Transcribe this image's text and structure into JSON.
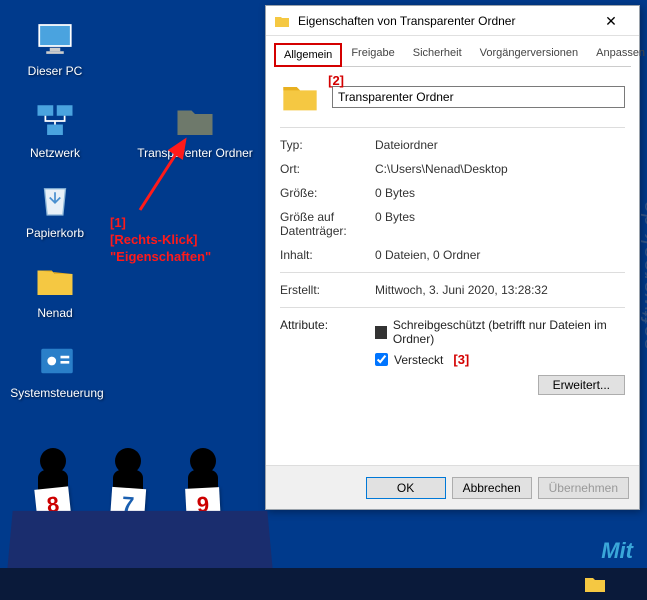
{
  "desktop": {
    "icons": [
      {
        "label": "Dieser PC"
      },
      {
        "label": "Netzwerk"
      },
      {
        "label": "Papierkorb"
      },
      {
        "label": "Nenad"
      },
      {
        "label": "Systemsteuerung"
      },
      {
        "label": "Transparenter Ordner"
      }
    ]
  },
  "annotation": {
    "step1_num": "[1]",
    "step1_action": "[Rechts-Klick]",
    "step1_menu": "\"Eigenschaften\"",
    "step2": "[2]",
    "step3": "[3]"
  },
  "dialog": {
    "title": "Eigenschaften von Transparenter Ordner",
    "tabs": [
      "Allgemein",
      "Freigabe",
      "Sicherheit",
      "Vorgängerversionen",
      "Anpassen"
    ],
    "active_tab": 0,
    "folder_name": "Transparenter Ordner",
    "props": {
      "type_label": "Typ:",
      "type_value": "Dateiordner",
      "loc_label": "Ort:",
      "loc_value": "C:\\Users\\Nenad\\Desktop",
      "size_label": "Größe:",
      "size_value": "0 Bytes",
      "sizeondisk_label": "Größe auf Datenträger:",
      "sizeondisk_value": "0 Bytes",
      "contains_label": "Inhalt:",
      "contains_value": "0 Dateien, 0 Ordner",
      "created_label": "Erstellt:",
      "created_value": "Mittwoch, 3. Juni 2020, 13:28:32"
    },
    "attributes": {
      "label": "Attribute:",
      "readonly_label": "Schreibgeschützt (betrifft nur Dateien im Ordner)",
      "readonly_checked": true,
      "hidden_label": "Versteckt",
      "hidden_checked": true,
      "advanced_label": "Erweitert..."
    },
    "buttons": {
      "ok": "OK",
      "cancel": "Abbrechen",
      "apply": "Übernehmen"
    }
  },
  "judges": {
    "scores": [
      "8",
      "7",
      "9"
    ]
  },
  "watermark": "softwareok.de",
  "branding": "Mit"
}
